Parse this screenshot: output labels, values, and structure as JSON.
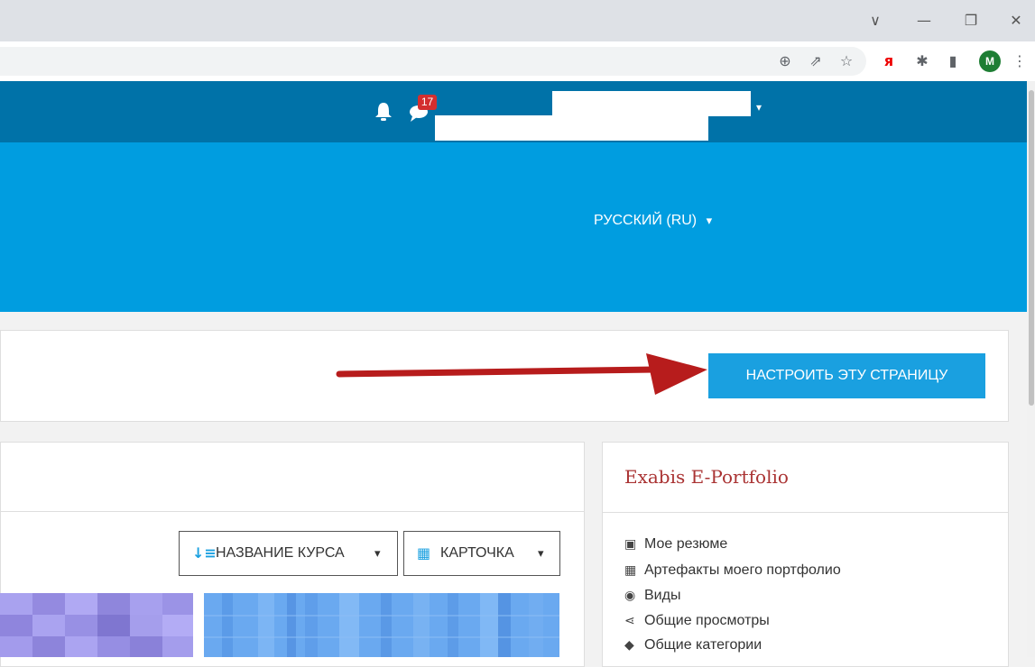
{
  "window_controls": {
    "chevron": "∨",
    "minimize": "—",
    "restore": "❐",
    "close": "✕"
  },
  "toolbar_icons": [
    "zoom-icon",
    "share-icon",
    "star-icon",
    "yandex-icon",
    "extensions-icon",
    "sidebar-icon"
  ],
  "toolbar_glyphs": {
    "zoom": "⊕",
    "share": "⇗",
    "star": "☆",
    "yandex": "я",
    "ext": "✱",
    "side": "▮",
    "more": "⋮"
  },
  "profile_initial": "M",
  "navbar": {
    "messages_badge": "17"
  },
  "language": {
    "label": "РУССКИЙ (RU)",
    "caret": "▾"
  },
  "customize_button": "НАСТРОИТЬ ЭТУ СТРАНИЦУ",
  "course_controls": {
    "sort_label": "НАЗВАНИЕ КУРСА",
    "view_label": "КАРТОЧКА",
    "caret": "▾"
  },
  "portfolio_block": {
    "title": "Exabis E-Portfolio",
    "items": [
      {
        "icon": "▣",
        "label": "Мое резюме"
      },
      {
        "icon": "▦",
        "label": "Артефакты моего портфолио"
      },
      {
        "icon": "◉",
        "label": "Виды"
      },
      {
        "icon": "⋖",
        "label": "Общие просмотры"
      },
      {
        "icon": "◆",
        "label": "Общие категории"
      }
    ]
  },
  "colors": {
    "navbar": "#0072a8",
    "hero": "#009de0",
    "button": "#1aa0e0",
    "arrow": "#b71c1c",
    "block_title": "#a33333"
  }
}
